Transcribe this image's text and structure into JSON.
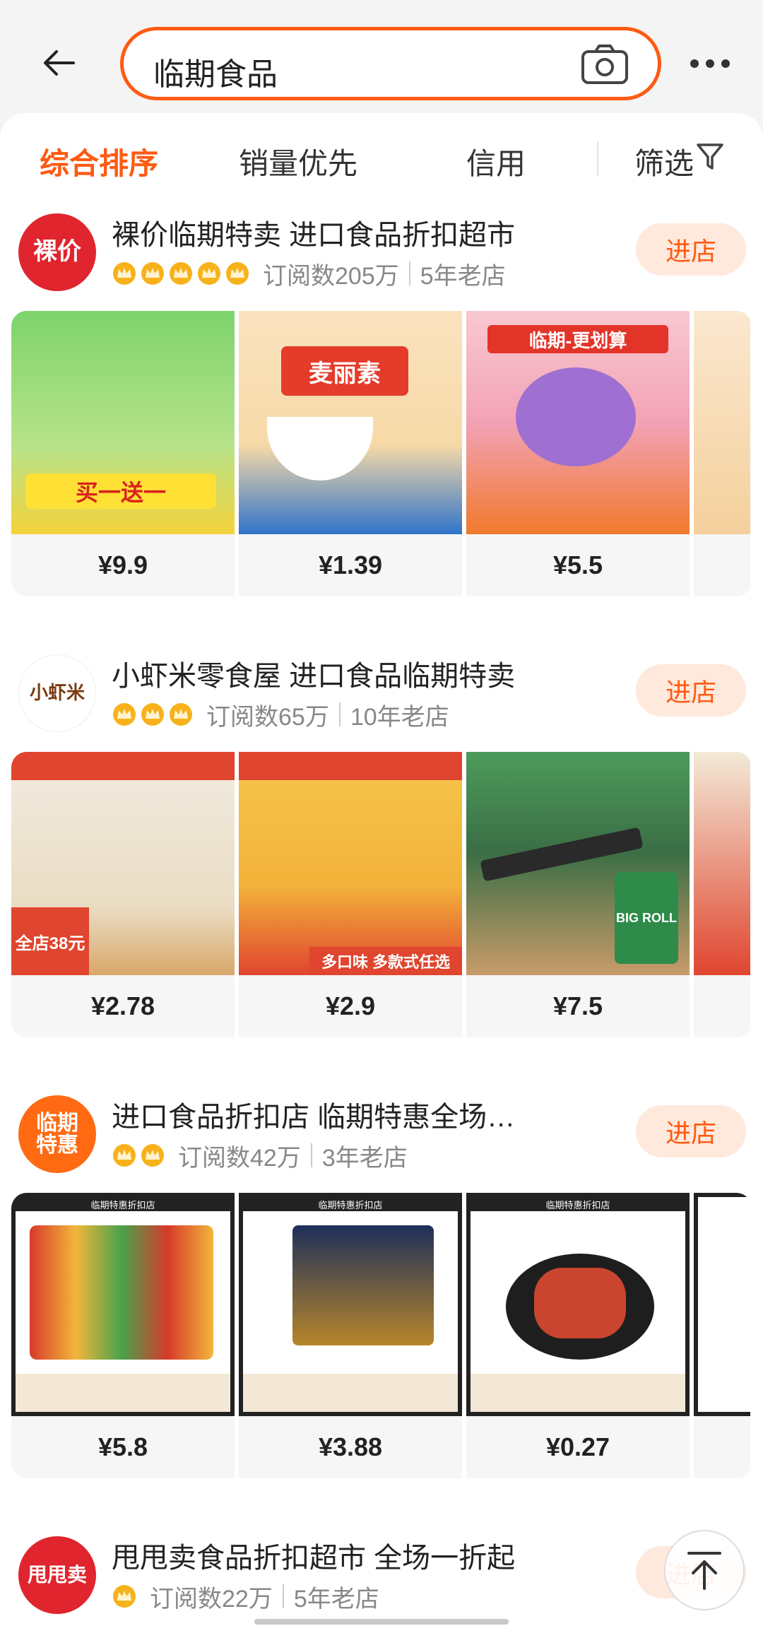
{
  "search": {
    "query": "临期食品"
  },
  "sort": {
    "comprehensive": "综合排序",
    "sales": "销量优先",
    "credit": "信用",
    "filter": "筛选"
  },
  "colors": {
    "accent": "#ff5a12",
    "enter_bg": "#ffe9dc"
  },
  "shops": [
    {
      "logo_text": "裸价",
      "name": "裸价临期特卖 进口食品折扣超市",
      "crowns": 5,
      "subscribers": "订阅数205万",
      "age": "5年老店",
      "enter": "进店",
      "items": [
        {
          "price": "¥9.9",
          "img_text": "买一送一"
        },
        {
          "price": "¥1.39",
          "img_text": "麦丽素"
        },
        {
          "price": "¥5.5",
          "img_text": "临期-更划算"
        }
      ]
    },
    {
      "logo_text": "小虾米",
      "name": "小虾米零食屋 进口食品临期特卖",
      "crowns": 3,
      "subscribers": "订阅数65万",
      "age": "10年老店",
      "enter": "进店",
      "items": [
        {
          "price": "¥2.78",
          "img_text": "全店38元"
        },
        {
          "price": "¥2.9",
          "img_text": "多口味 多款式任选"
        },
        {
          "price": "¥7.5",
          "img_text": "BIG ROLL"
        }
      ]
    },
    {
      "logo_text": "临期特惠",
      "name": "进口食品折扣店  临期特惠全场…",
      "crowns": 2,
      "subscribers": "订阅数42万",
      "age": "3年老店",
      "enter": "进店",
      "items": [
        {
          "price": "¥5.8",
          "img_text": "临期特惠折扣店"
        },
        {
          "price": "¥3.88",
          "img_text": "临期特惠折扣店"
        },
        {
          "price": "¥0.27",
          "img_text": "临期特惠折扣店"
        }
      ]
    },
    {
      "logo_text": "甩甩卖",
      "name": "甩甩卖食品折扣超市 全场一折起",
      "crowns": 1,
      "subscribers": "订阅数22万",
      "age": "5年老店",
      "enter": "进店"
    }
  ]
}
